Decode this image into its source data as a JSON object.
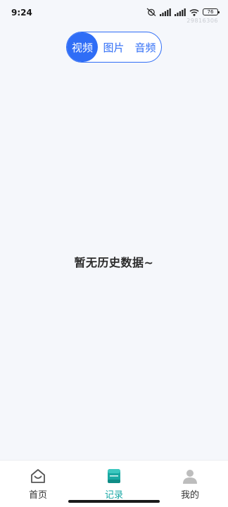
{
  "status_bar": {
    "time": "9:24",
    "battery": "76",
    "watermark": "29816306",
    "icons": [
      "alarm-off-icon",
      "signal-4g-icon",
      "signal-hd-icon",
      "wifi-icon",
      "battery-icon"
    ]
  },
  "segment": {
    "items": [
      {
        "label": "视频",
        "active": true
      },
      {
        "label": "图片",
        "active": false
      },
      {
        "label": "音频",
        "active": false
      }
    ],
    "accent": "#2f6df6"
  },
  "main": {
    "empty_message": "暂无历史数据~"
  },
  "tabbar": {
    "items": [
      {
        "label": "首页",
        "icon": "home-icon",
        "active": false
      },
      {
        "label": "记录",
        "icon": "book-icon",
        "active": true
      },
      {
        "label": "我的",
        "icon": "user-icon",
        "active": false
      }
    ],
    "active_color": "#18a7a5"
  }
}
